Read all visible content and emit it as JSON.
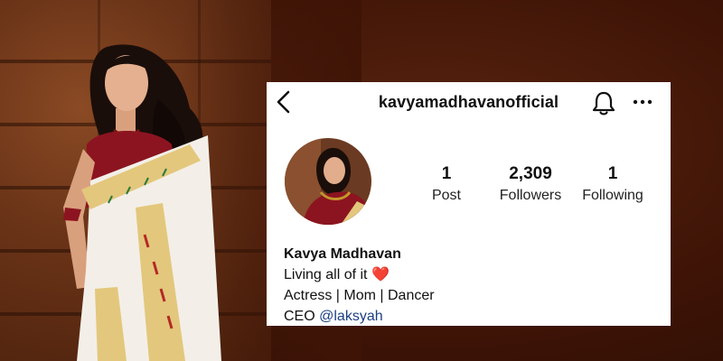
{
  "profile": {
    "username": "kavyamadhavanofficial",
    "stats": {
      "posts": {
        "value": "1",
        "label": "Post"
      },
      "followers": {
        "value": "2,309",
        "label": "Followers"
      },
      "following": {
        "value": "1",
        "label": "Following"
      }
    },
    "bio": {
      "name": "Kavya Madhavan",
      "line1": "Living all of it",
      "line1_emoji": "❤️",
      "line2": "Actress | Mom | Dancer",
      "line3_prefix": "CEO",
      "line3_mention": "@laksyah"
    }
  },
  "icons": {
    "back": "chevron-left-icon",
    "notifications": "bell-icon",
    "more": "more-horizontal-icon"
  },
  "colors": {
    "background": "#4a1a08",
    "card": "#ffffff",
    "mention": "#1b3f83",
    "heart": "#e0162b",
    "saree_red": "#8c1420",
    "saree_gold": "#e3c77c"
  }
}
